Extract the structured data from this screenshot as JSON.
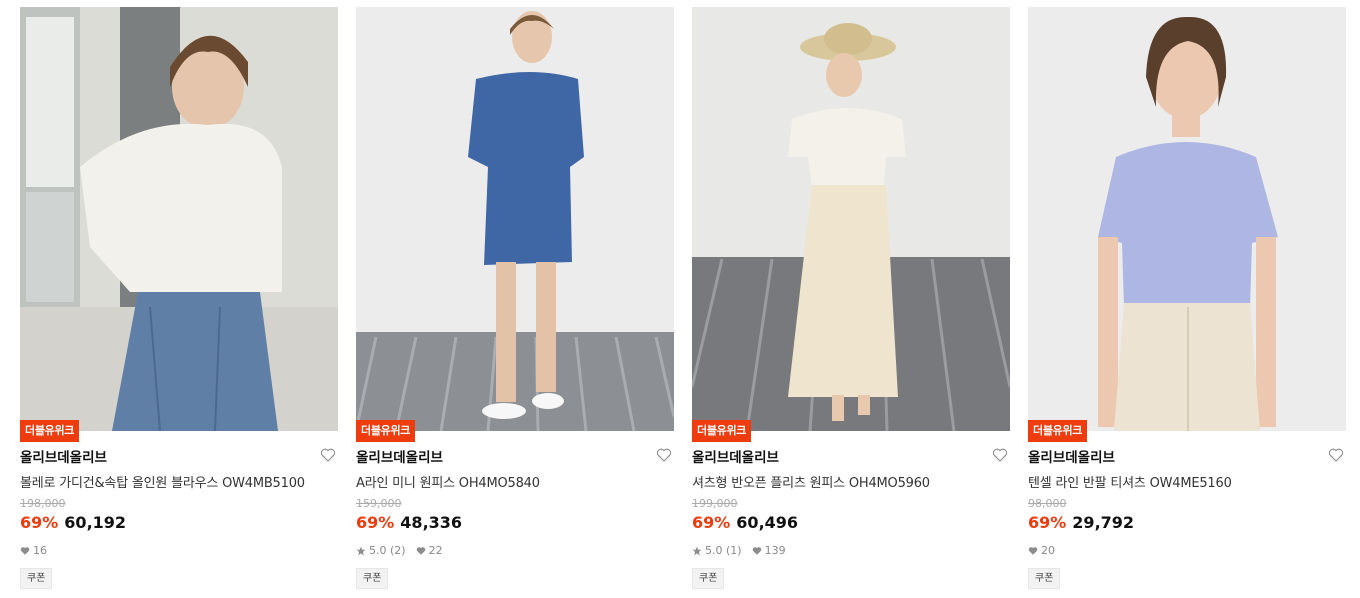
{
  "products": [
    {
      "badge": "더블유위크",
      "brand": "올리브데올리브",
      "name": "볼레로 가디건&속탑 올인원 블라우스 OW4MB5100",
      "original_price": "198,000",
      "discount": "69%",
      "price": "60,192",
      "rating": "",
      "review_count": "",
      "likes": "16",
      "coupon": "쿠폰"
    },
    {
      "badge": "더블유위크",
      "brand": "올리브데올리브",
      "name": "A라인 미니 원피스 OH4MO5840",
      "original_price": "159,000",
      "discount": "69%",
      "price": "48,336",
      "rating": "5.0",
      "review_count": "(2)",
      "likes": "22",
      "coupon": "쿠폰"
    },
    {
      "badge": "더블유위크",
      "brand": "올리브데올리브",
      "name": "셔츠형 반오픈 플리츠 원피스 OH4MO5960",
      "original_price": "199,000",
      "discount": "69%",
      "price": "60,496",
      "rating": "5.0",
      "review_count": "(1)",
      "likes": "139",
      "coupon": "쿠폰"
    },
    {
      "badge": "더블유위크",
      "brand": "올리브데올리브",
      "name": "텐셀 라인 반팔 티셔츠 OW4ME5160",
      "original_price": "98,000",
      "discount": "69%",
      "price": "29,792",
      "rating": "",
      "review_count": "",
      "likes": "20",
      "coupon": "쿠폰"
    }
  ],
  "colors": {
    "accent": "#ef3c0f",
    "icon_grey": "#8c8c8c"
  },
  "icons": {
    "wishlist": "heart-outline-icon",
    "likes": "heart-filled-icon",
    "rating": "star-icon"
  }
}
